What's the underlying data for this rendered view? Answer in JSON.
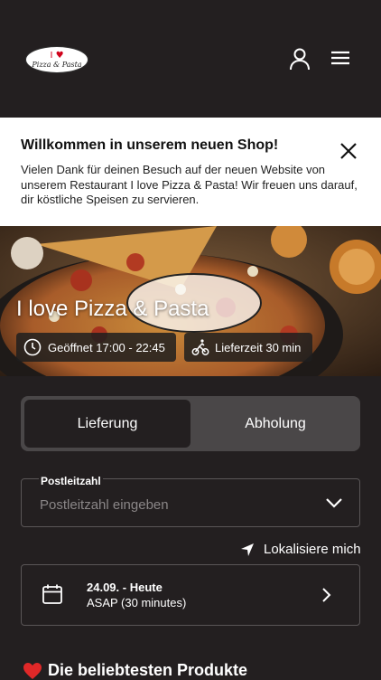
{
  "header": {
    "logo_text": "Pizza & Pasta",
    "logo_heart": "I ♥",
    "icons": [
      "user-icon",
      "menu-icon"
    ]
  },
  "banner": {
    "title": "Willkommen in unserem neuen Shop!",
    "text": "Vielen Dank für deinen Besuch auf der neuen Website von unserem Restaurant I love Pizza & Pasta! Wir freuen uns darauf, dir köstliche Speisen zu servieren."
  },
  "hero": {
    "title": "I love Pizza & Pasta",
    "opening": "Geöffnet 17:00 - 22:45",
    "delivery_time": "Lieferzeit 30 min"
  },
  "order_mode": {
    "delivery": "Lieferung",
    "pickup": "Abholung",
    "selected": "Lieferung"
  },
  "zip": {
    "label": "Postleitzahl",
    "placeholder": "Postleitzahl eingeben"
  },
  "locate_label": "Lokalisiere mich",
  "schedule": {
    "date": "24.09. - Heute",
    "time": "ASAP (30 minutes)"
  },
  "popular_title": "Die beliebtesten Produkte",
  "colors": {
    "background": "#231f20",
    "accent_red": "#e02828",
    "toggle_bg": "#4a4748"
  }
}
